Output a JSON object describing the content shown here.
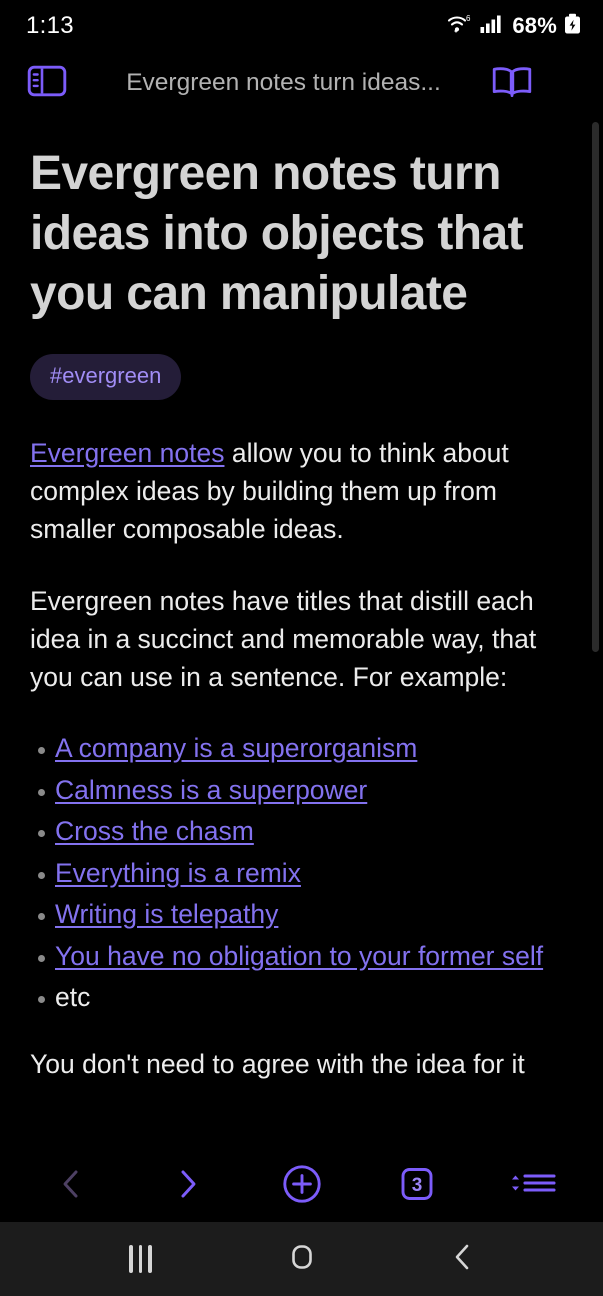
{
  "status_bar": {
    "time": "1:13",
    "battery_text": "68%",
    "icons": [
      "wifi-6-icon",
      "cellular-signal-icon",
      "battery-charging-icon"
    ]
  },
  "toolbar": {
    "sidebar_toggle_name": "sidebar-toggle-icon",
    "title": "Evergreen notes turn ideas...",
    "reader_mode_name": "open-book-icon",
    "overflow_name": "kebab-menu-icon"
  },
  "note": {
    "title": "Evergreen notes turn ideas into objects that you can manipulate",
    "tag": "#evergreen",
    "paragraph_1": {
      "link_text": "Evergreen notes",
      "rest": " allow you to think about complex ideas by building them up from smaller composable ideas."
    },
    "paragraph_2": "Evergreen notes have titles that distill each idea in a succinct and memorable way, that you can use in a sentence. For example:",
    "examples": [
      {
        "label": "A company is a superorganism",
        "is_link": true
      },
      {
        "label": "Calmness is a superpower",
        "is_link": true
      },
      {
        "label": "Cross the chasm",
        "is_link": true
      },
      {
        "label": "Everything is a remix",
        "is_link": true
      },
      {
        "label": "Writing is telepathy",
        "is_link": true
      },
      {
        "label": "You have no obligation to your former self",
        "is_link": true
      },
      {
        "label": "etc",
        "is_link": false
      }
    ],
    "paragraph_3_clipped": "You don't need to agree with the idea for it"
  },
  "bottom_bar": {
    "back_label": "back-chevron-icon",
    "forward_label": "forward-chevron-icon",
    "new_tab_label": "plus-circle-icon",
    "tab_count": "3",
    "sort_label": "sort-list-icon"
  },
  "nav_bar": {
    "recents_label": "recents-icon",
    "home_label": "home-icon",
    "back_label": "back-icon"
  },
  "colors": {
    "background": "#000000",
    "accent_purple": "#7c5cfa",
    "link_purple": "#8372ef",
    "tag_bg": "#241d38",
    "tag_text": "#a18df5",
    "body_text": "#ececec",
    "title_text": "#d4d4d4",
    "toolbar_title_text": "#b2b2b2",
    "navbar_bg": "#1c1c1c"
  }
}
